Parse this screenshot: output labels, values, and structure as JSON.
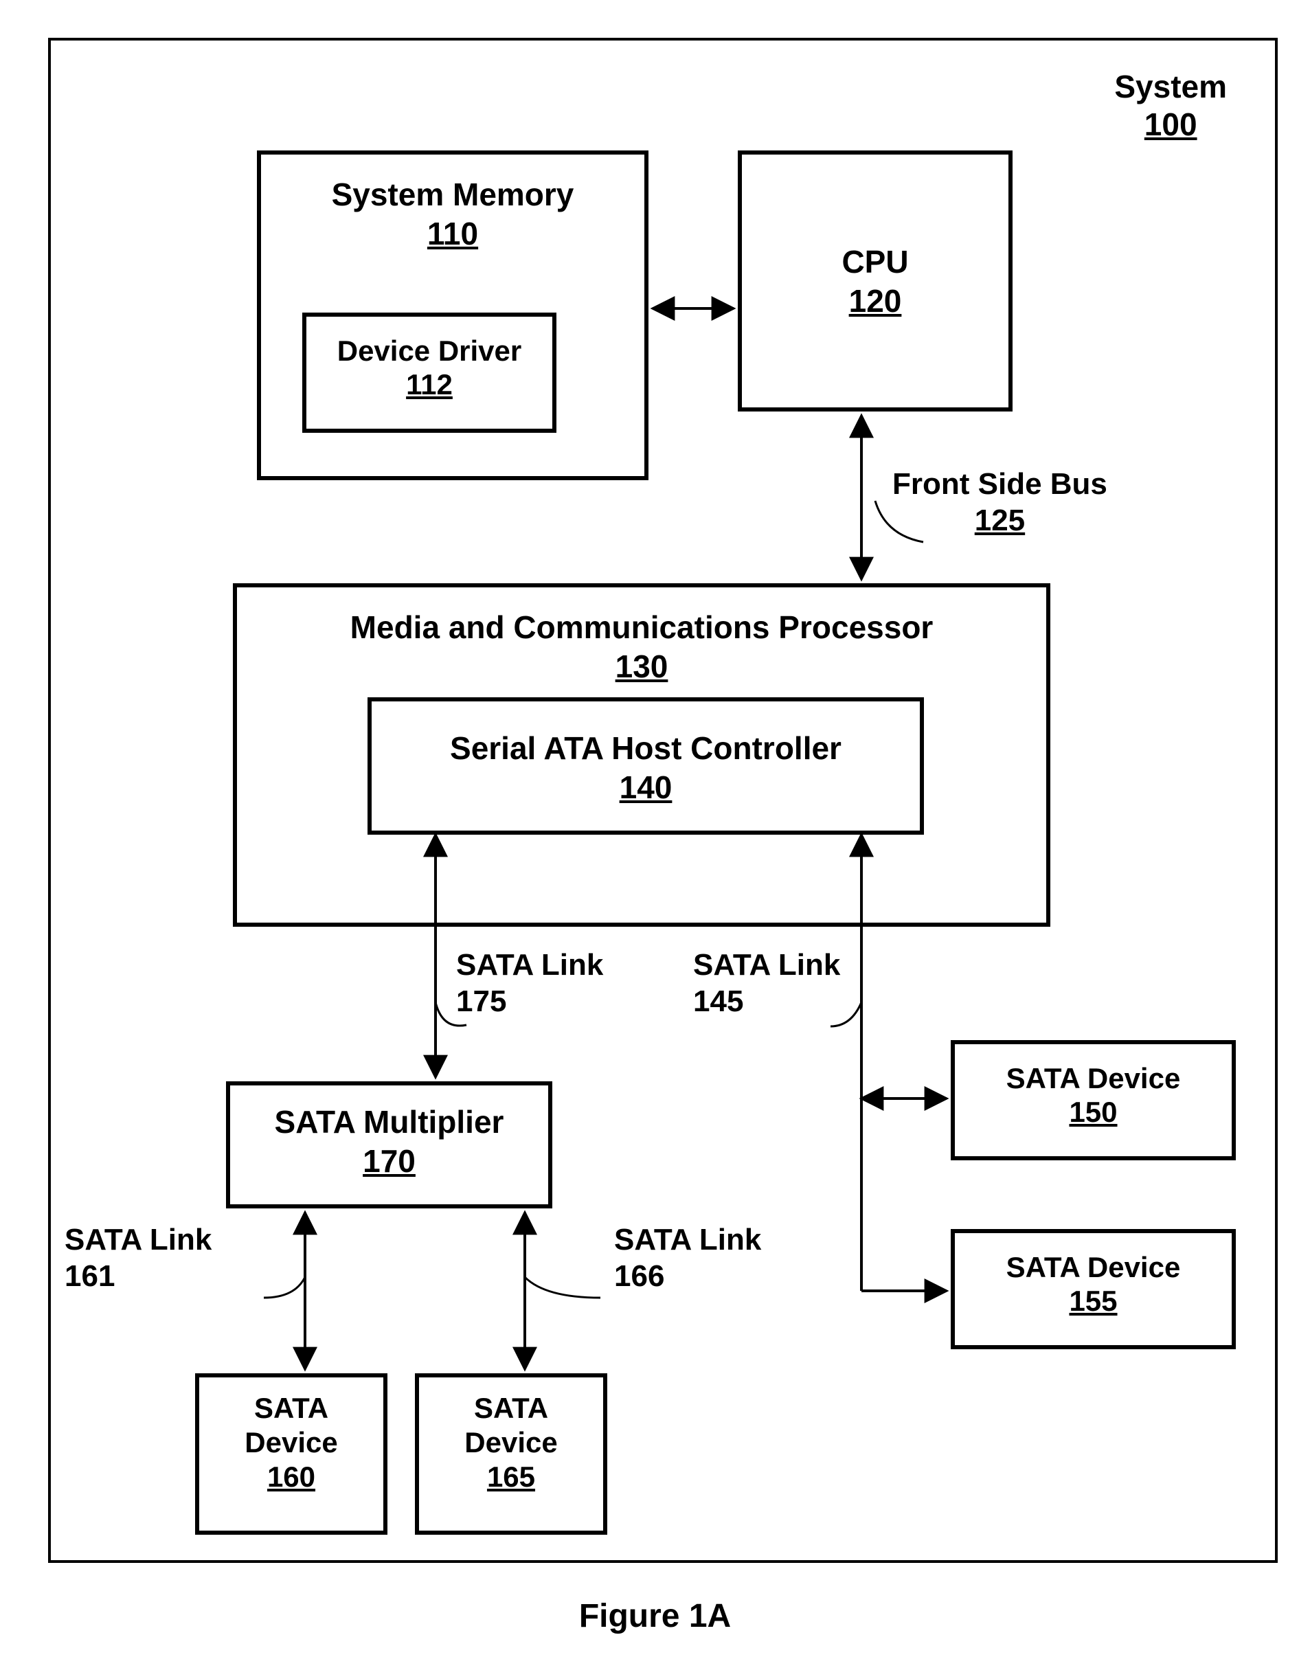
{
  "diagram": {
    "system_label": "System",
    "system_num": "100",
    "sysmem_label": "System Memory",
    "sysmem_num": "110",
    "devdrv_label": "Device Driver",
    "devdrv_num": "112",
    "cpu_label": "CPU",
    "cpu_num": "120",
    "fsb_label": "Front Side Bus",
    "fsb_num": "125",
    "mcp_label": "Media and Communications Processor",
    "mcp_num": "130",
    "sata_host_label": "Serial ATA Host Controller",
    "sata_host_num": "140",
    "sata_link_175_label": "SATA Link",
    "sata_link_175_num": "175",
    "sata_link_145_label": "SATA Link",
    "sata_link_145_num": "145",
    "sata_mult_label": "SATA Multiplier",
    "sata_mult_num": "170",
    "sata_link_161_label": "SATA Link",
    "sata_link_161_num": "161",
    "sata_link_166_label": "SATA Link",
    "sata_link_166_num": "166",
    "sata_dev_150_label": "SATA Device",
    "sata_dev_150_num": "150",
    "sata_dev_155_label": "SATA Device",
    "sata_dev_155_num": "155",
    "sata_dev_160_label": "SATA Device",
    "sata_dev_160_num": "160",
    "sata_dev_165_label": "SATA Device",
    "sata_dev_165_num": "165",
    "figure_caption": "Figure 1A"
  }
}
